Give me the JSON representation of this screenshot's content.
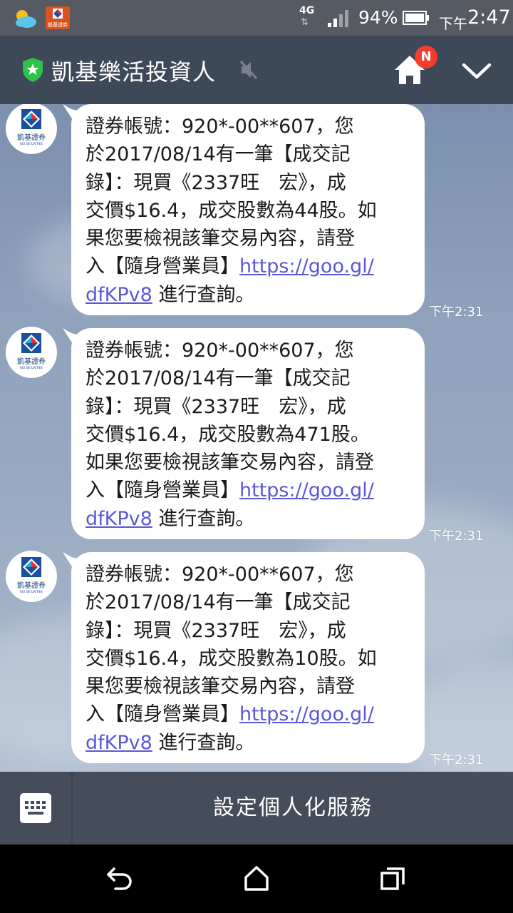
{
  "status_bar": {
    "network": "4G",
    "battery_percent": "94%",
    "clock_prefix": "下午",
    "clock_time": "2:47",
    "notification_app_label": "凱基證券"
  },
  "header": {
    "title": "凱基樂活投資人",
    "badge": "N"
  },
  "avatar": {
    "name": "凱基證券",
    "subtitle": "KGI SECURITIES"
  },
  "messages": [
    {
      "lines": [
        "證券帳號：920*-00**607，您",
        "於2017/08/14有一筆【成交記",
        "錄】：現買《2337旺　宏》，成",
        "交價$16.4，成交股數為44股。如",
        "果您要檢視該筆交易內容，請登"
      ],
      "link_prefix": "入【隨身營業員】",
      "link_part1": "https://goo.gl/",
      "link_part2": "dfKPv8",
      "suffix": " 進行查詢。",
      "time": "下午2:31"
    },
    {
      "lines": [
        "證券帳號：920*-00**607，您",
        "於2017/08/14有一筆【成交記",
        "錄】：現買《2337旺　宏》，成",
        "交價$16.4，成交股數為471股。",
        "如果您要檢視該筆交易內容，請登"
      ],
      "link_prefix": "入【隨身營業員】",
      "link_part1": "https://goo.gl/",
      "link_part2": "dfKPv8",
      "suffix": " 進行查詢。",
      "time": "下午2:31"
    },
    {
      "lines": [
        "證券帳號：920*-00**607，您",
        "於2017/08/14有一筆【成交記",
        "錄】：現買《2337旺　宏》，成",
        "交價$16.4，成交股數為10股。如",
        "果您要檢視該筆交易內容，請登"
      ],
      "link_prefix": "入【隨身營業員】",
      "link_part1": "https://goo.gl/",
      "link_part2": "dfKPv8",
      "suffix": " 進行查詢。",
      "time": "下午2:31"
    }
  ],
  "bottom_bar": {
    "menu_label": "設定個人化服務"
  },
  "colors": {
    "header_bg": "#3d4858",
    "status_bg": "#555a63",
    "link": "#5a58d8",
    "badge": "#f33d2e",
    "shield": "#2fc24a"
  },
  "icons": [
    "weather-icon",
    "kgi-notification-icon",
    "signal-icon",
    "battery-icon",
    "shield-icon",
    "mute-icon",
    "home-icon",
    "chevron-down-icon",
    "keyboard-icon",
    "back-icon",
    "home-nav-icon",
    "recents-icon"
  ]
}
